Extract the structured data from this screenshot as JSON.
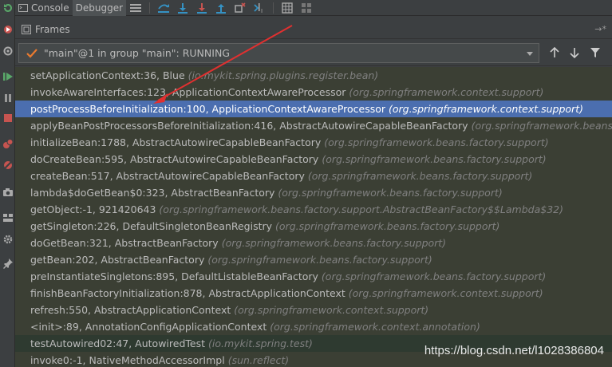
{
  "toolbar": {
    "tabs": [
      {
        "label": "Console",
        "icon": "console-icon"
      },
      {
        "label": "Debugger",
        "icon": "debugger-icon"
      }
    ],
    "buttons": [
      "show-execution-point-icon",
      "step-over-icon",
      "step-into-icon",
      "force-step-into-icon",
      "step-out-icon",
      "drop-frame-icon",
      "run-to-cursor-icon",
      "evaluate-icon",
      "layout-icon"
    ]
  },
  "frames_panel": {
    "title": "Frames",
    "thread_label": "\"main\"@1 in group \"main\": RUNNING"
  },
  "frames": [
    {
      "method": "setApplicationContext:36, Blue",
      "pkg": "(io.mykit.spring.plugins.register.bean)",
      "style": "olive"
    },
    {
      "method": "invokeAwareInterfaces:123, ApplicationContextAwareProcessor",
      "pkg": "(org.springframework.context.support)",
      "style": "olive"
    },
    {
      "method": "postProcessBeforeInitialization:100, ApplicationContextAwareProcessor",
      "pkg": "(org.springframework.context.support)",
      "style": "selected"
    },
    {
      "method": "applyBeanPostProcessorsBeforeInitialization:416, AbstractAutowireCapableBeanFactory",
      "pkg": "(org.springframework.beans.factory.",
      "style": "olive"
    },
    {
      "method": "initializeBean:1788, AbstractAutowireCapableBeanFactory",
      "pkg": "(org.springframework.beans.factory.support)",
      "style": "olive"
    },
    {
      "method": "doCreateBean:595, AbstractAutowireCapableBeanFactory",
      "pkg": "(org.springframework.beans.factory.support)",
      "style": "olive"
    },
    {
      "method": "createBean:517, AbstractAutowireCapableBeanFactory",
      "pkg": "(org.springframework.beans.factory.support)",
      "style": "olive"
    },
    {
      "method": "lambda$doGetBean$0:323, AbstractBeanFactory",
      "pkg": "(org.springframework.beans.factory.support)",
      "style": "olive"
    },
    {
      "method": "getObject:-1, 921420643",
      "pkg": "(org.springframework.beans.factory.support.AbstractBeanFactory$$Lambda$32)",
      "style": "olive"
    },
    {
      "method": "getSingleton:226, DefaultSingletonBeanRegistry",
      "pkg": "(org.springframework.beans.factory.support)",
      "style": "olive"
    },
    {
      "method": "doGetBean:321, AbstractBeanFactory",
      "pkg": "(org.springframework.beans.factory.support)",
      "style": "olive"
    },
    {
      "method": "getBean:202, AbstractBeanFactory",
      "pkg": "(org.springframework.beans.factory.support)",
      "style": "olive"
    },
    {
      "method": "preInstantiateSingletons:895, DefaultListableBeanFactory",
      "pkg": "(org.springframework.beans.factory.support)",
      "style": "olive"
    },
    {
      "method": "finishBeanFactoryInitialization:878, AbstractApplicationContext",
      "pkg": "(org.springframework.context.support)",
      "style": "olive"
    },
    {
      "method": "refresh:550, AbstractApplicationContext",
      "pkg": "(org.springframework.context.support)",
      "style": "olive"
    },
    {
      "method": "<init>:89, AnnotationConfigApplicationContext",
      "pkg": "(org.springframework.context.annotation)",
      "style": "olive"
    },
    {
      "method": "testAutowired02:47, AutowiredTest",
      "pkg": "(io.mykit.spring.test)",
      "style": "dark"
    },
    {
      "method": "invoke0:-1, NativeMethodAccessorImpl",
      "pkg": "(sun.reflect)",
      "style": "olive"
    }
  ],
  "watermark": "https://blog.csdn.net/l1028386804",
  "colors": {
    "background": "#3c3f41",
    "selected_row": "#4b6eaf",
    "frame_row": "#3b3f34",
    "arrow": "#e03030"
  }
}
